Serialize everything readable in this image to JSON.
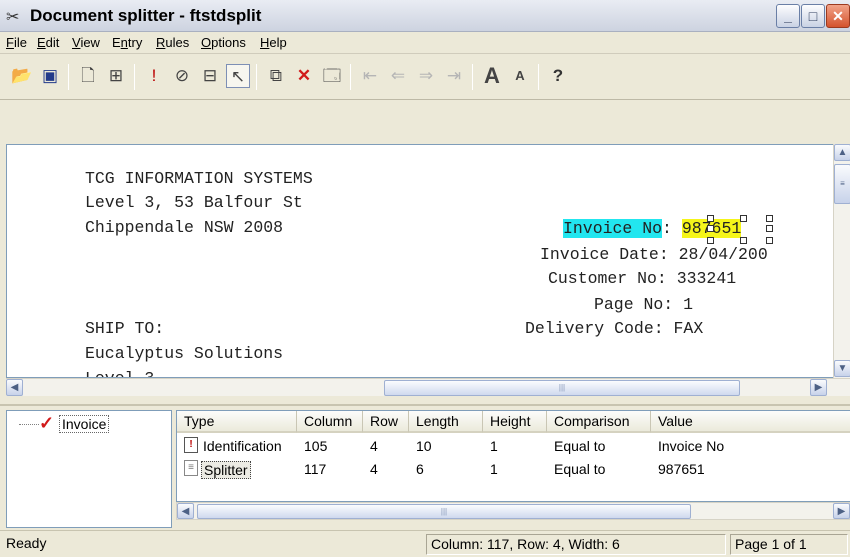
{
  "window": {
    "title": "Document splitter - ftstdsplit",
    "icon": "scissors-icon"
  },
  "menu": [
    {
      "label": "File",
      "key": "F",
      "rest": "ile"
    },
    {
      "label": "Edit",
      "key": "E",
      "rest": "dit"
    },
    {
      "label": "View",
      "key": "V",
      "rest": "iew"
    },
    {
      "label": "Entry",
      "pre": "E",
      "key": "n",
      "rest": "try"
    },
    {
      "label": "Rules",
      "key": "R",
      "rest": "ules"
    },
    {
      "label": "Options",
      "key": "O",
      "rest": "ptions"
    },
    {
      "label": "Help",
      "key": "H",
      "rest": "elp"
    }
  ],
  "toolbar": {
    "icons": [
      "open-folder-icon",
      "save-icon",
      "new-entry-icon",
      "add-field-icon",
      "identification-icon",
      "splitter-icon",
      "zone-icon",
      "pointer-icon",
      "copy-icon",
      "delete-icon",
      "properties-icon",
      "first-page-icon",
      "prev-page-icon",
      "next-page-icon",
      "last-page-icon",
      "font-larger-icon",
      "font-smaller-icon",
      "help-icon"
    ]
  },
  "document": {
    "lines": {
      "l1": "TCG INFORMATION SYSTEMS",
      "l2": "Level 3, 53 Balfour St",
      "l3": "Chippendale NSW 2008",
      "invoice_no_label": "Invoice No",
      "invoice_no_colon": ":",
      "invoice_no_value": "987651",
      "invoice_date": "Invoice Date: 28/04/200",
      "customer_no": "Customer No: 333241",
      "page_no": "Page No: 1",
      "delivery_code": "Delivery Code: FAX",
      "ship_to": "SHIP TO:",
      "ship_name": "Eucalyptus Solutions",
      "cut_line": "Level 3"
    }
  },
  "tree": {
    "items": [
      {
        "label": "Invoice",
        "checked": true
      }
    ]
  },
  "grid": {
    "headers": [
      "Type",
      "Column",
      "Row",
      "Length",
      "Height",
      "Comparison",
      "Value"
    ],
    "rows": [
      {
        "type": "Identification",
        "column": "105",
        "row": "4",
        "length": "10",
        "height": "1",
        "comparison": "Equal to",
        "value": "Invoice No"
      },
      {
        "type": "Splitter",
        "column": "117",
        "row": "4",
        "length": "6",
        "height": "1",
        "comparison": "Equal to",
        "value": "987651"
      }
    ]
  },
  "status": {
    "left": "Ready",
    "position": "Column: 117, Row: 4, Width: 6",
    "page": "Page 1 of 1"
  }
}
